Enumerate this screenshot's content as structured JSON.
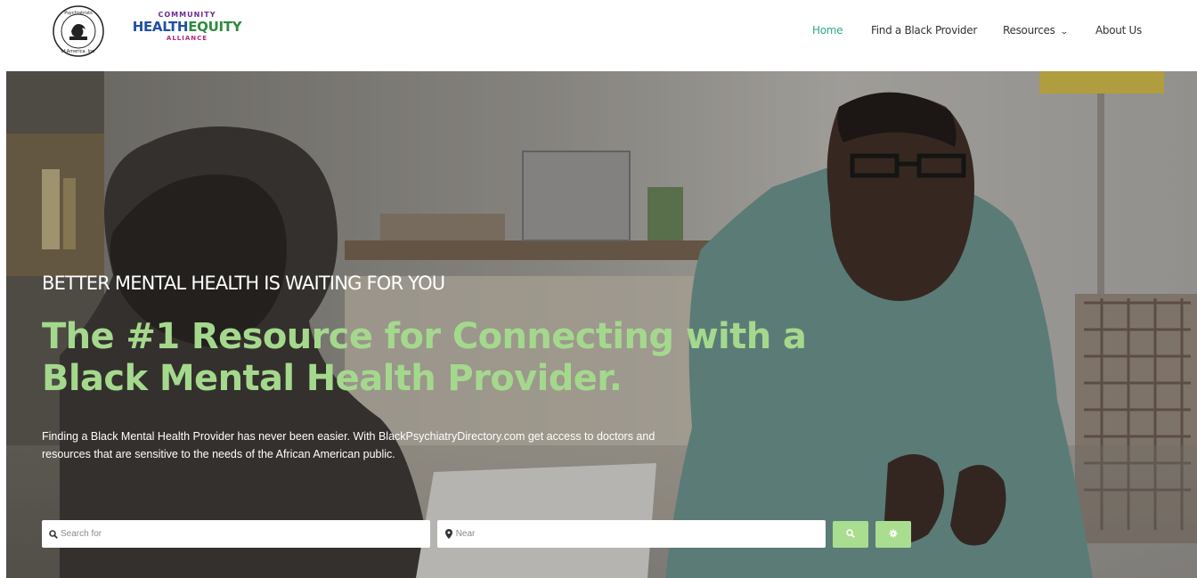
{
  "brand": {
    "seal_text": "Black Psychiatrists of America, Inc.",
    "logo_top": "COMMUNITY",
    "logo_mid_a": "HEALTH",
    "logo_mid_b": "EQUITY",
    "logo_bottom": "ALLIANCE"
  },
  "nav": {
    "home": "Home",
    "find": "Find a Black Provider",
    "resources": "Resources",
    "about": "About Us",
    "active_color": "#2fa68a"
  },
  "hero": {
    "eyebrow": "BETTER MENTAL HEALTH IS WAITING FOR YOU",
    "headline": "The #1 Resource for Connecting with a Black Mental Health Provider.",
    "lede": "Finding a Black Mental Health Provider has never been easier. With BlackPsychiatryDirectory.com get access to doctors and resources that are sensitive to the needs of the African American public.",
    "headline_color": "#a4d98d"
  },
  "search": {
    "for_placeholder": "Search for",
    "near_placeholder": "Near",
    "for_value": "",
    "near_value": "",
    "button_color": "#a9dd8f"
  },
  "icons": {
    "search": "search-icon",
    "location": "location-pin-icon",
    "settings": "gear-icon",
    "dropdown": "chevron-down-icon"
  }
}
